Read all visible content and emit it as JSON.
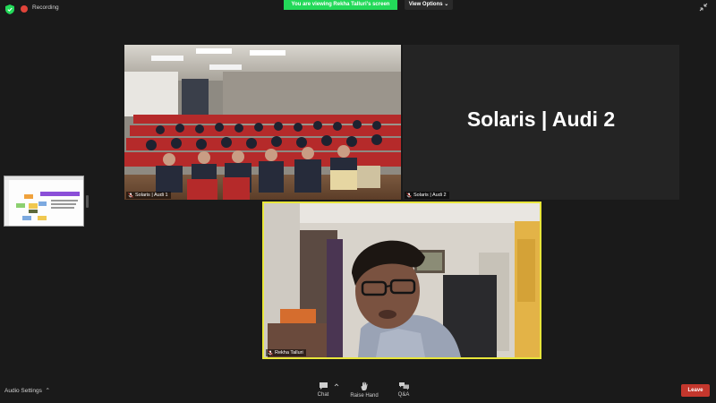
{
  "top_bar": {
    "recording_label": "Recording",
    "viewing_banner": "You are viewing Rekha Talluri's screen",
    "view_options_label": "View Options"
  },
  "tiles": {
    "audi1": {
      "name": "Solaris | Audi 1"
    },
    "audi2": {
      "name": "Solaris | Audi 2",
      "display_text": "Solaris | Audi 2"
    },
    "rekha": {
      "name": "Rekha Talluri"
    }
  },
  "bottom_bar": {
    "audio_settings_label": "Audio Settings",
    "chat_label": "Chat",
    "raise_hand_label": "Raise Hand",
    "qa_label": "Q&A",
    "leave_label": "Leave"
  },
  "colors": {
    "banner_green": "#23d959",
    "active_speaker_border": "#e8e63a",
    "leave_red": "#c4372d",
    "background": "#1a1a1a"
  },
  "icons": [
    "shield-icon",
    "record-icon",
    "collapse-icon",
    "mic-muted-icon",
    "chat-icon",
    "raise-hand-icon",
    "qa-icon",
    "chevron-up-icon",
    "chevron-down-icon"
  ]
}
